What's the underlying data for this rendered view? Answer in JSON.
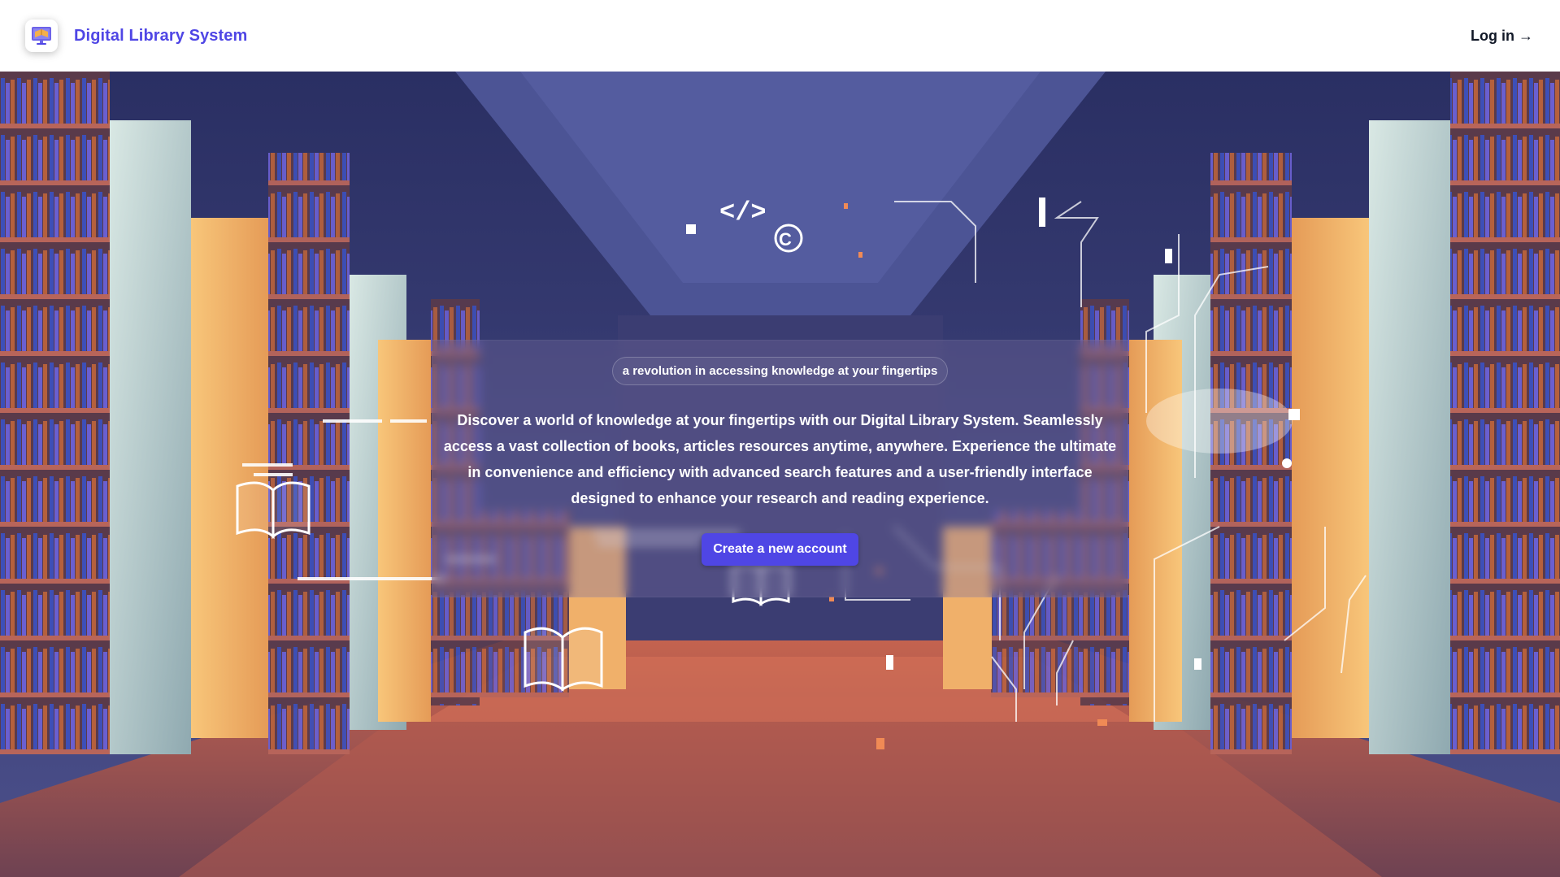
{
  "header": {
    "brand_name": "Digital Library System",
    "login_label": "Log in →"
  },
  "hero": {
    "tagline": "a revolution in accessing knowledge at your fingertips",
    "description": "Discover a world of knowledge at your fingertips with our Digital Library System. Seamlessly access a vast collection of books, articles resources anytime, anywhere. Experience the ultimate in convenience and efficiency with advanced search features and a user-friendly interface designed to enhance your research and reading experience.",
    "cta_label": "Create a new account"
  },
  "colors": {
    "brand": "#4f46e5",
    "header_bg": "#ffffff",
    "text_dark": "#111827"
  },
  "icons": {
    "logo": "library-screen-logo-icon"
  }
}
